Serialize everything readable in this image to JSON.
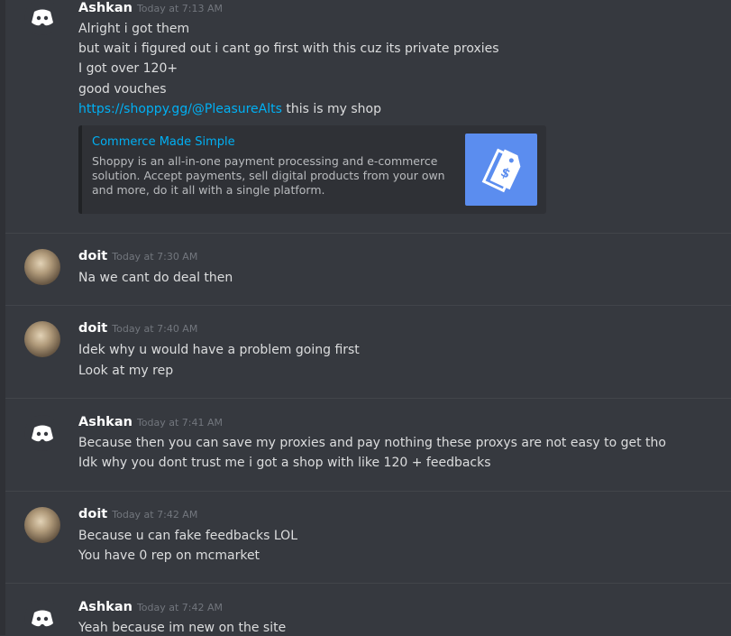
{
  "messages": [
    {
      "author": "Ashkan",
      "timestamp": "Today at 7:13 AM",
      "avatar": "discord-logo-icon",
      "lines": [
        "Alright i got them",
        "but wait i figured out i cant go first with this cuz its private proxies",
        "I got over 120+",
        "good vouches"
      ],
      "link_line": {
        "link": "https://shoppy.gg/@PleasureAlts",
        "text": " this is my shop"
      },
      "embed": {
        "title": "Commerce Made Simple",
        "description": "Shoppy is an all-in-one payment processing and e-commerce solution. Accept payments, sell digital products from your own and more, do it all with a single platform.",
        "thumbnail_icon": "price-tag-icon",
        "thumbnail_color": "#5b8def"
      }
    },
    {
      "author": "doit",
      "timestamp": "Today at 7:30 AM",
      "avatar": "user-photo",
      "lines": [
        "Na we cant do deal then"
      ]
    },
    {
      "author": "doit",
      "timestamp": "Today at 7:40 AM",
      "avatar": "user-photo",
      "lines": [
        "Idek why u would have a problem going first",
        "Look at my rep"
      ]
    },
    {
      "author": "Ashkan",
      "timestamp": "Today at 7:41 AM",
      "avatar": "discord-logo-icon",
      "lines": [
        "Because then you can save my proxies and pay nothing these proxys are not easy to get tho",
        "Idk why you dont trust me i got a shop with like 120 + feedbacks"
      ]
    },
    {
      "author": "doit",
      "timestamp": "Today at 7:42 AM",
      "avatar": "user-photo",
      "lines": [
        "Because u can fake feedbacks LOL",
        "You have 0 rep on mcmarket"
      ]
    },
    {
      "author": "Ashkan",
      "timestamp": "Today at 7:42 AM",
      "avatar": "discord-logo-icon",
      "lines": [
        "Yeah because im new on the site"
      ]
    }
  ],
  "colors": {
    "background": "#36393f",
    "text": "#dcddde",
    "link": "#00b0f4",
    "timestamp": "#72767d"
  }
}
